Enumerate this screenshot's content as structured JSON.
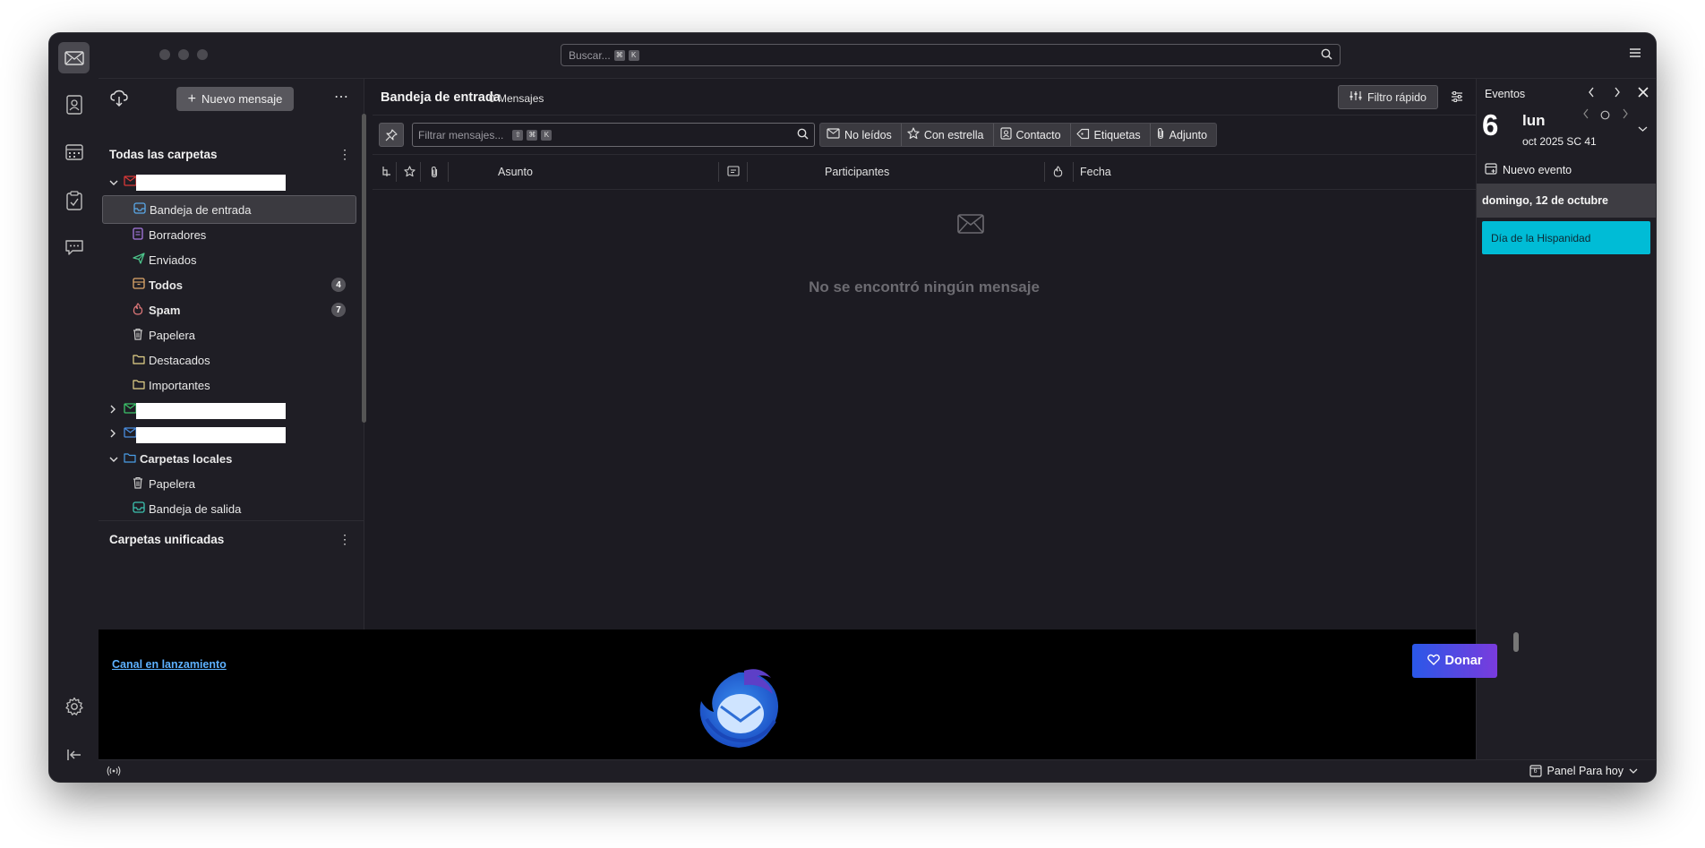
{
  "header": {
    "search_placeholder": "Buscar...",
    "search_kbd": [
      "⌘",
      "K"
    ]
  },
  "folderpane": {
    "new_message_label": "Nuevo mensaje",
    "all_folders_title": "Todas las carpetas",
    "account_folders": [
      {
        "label": "Bandeja de entrada",
        "bold": false,
        "badge": ""
      },
      {
        "label": "Borradores",
        "bold": false,
        "badge": ""
      },
      {
        "label": "Enviados",
        "bold": false,
        "badge": ""
      },
      {
        "label": "Todos",
        "bold": true,
        "badge": "4"
      },
      {
        "label": "Spam",
        "bold": true,
        "badge": "7"
      },
      {
        "label": "Papelera",
        "bold": false,
        "badge": ""
      },
      {
        "label": "Destacados",
        "bold": false,
        "badge": ""
      },
      {
        "label": "Importantes",
        "bold": false,
        "badge": ""
      }
    ],
    "local_folders_label": "Carpetas locales",
    "local_folders": [
      {
        "label": "Papelera"
      },
      {
        "label": "Bandeja de salida"
      }
    ],
    "unified_title": "Carpetas unificadas"
  },
  "messagepane": {
    "folder_title": "Bandeja de entrada",
    "message_count": "0 Mensajes",
    "quick_filter_label": "Filtro rápido",
    "filter_placeholder": "Filtrar mensajes...",
    "filter_kbd": [
      "⇧",
      "⌘",
      "K"
    ],
    "filter_buttons": [
      "No leídos",
      "Con estrella",
      "Contacto",
      "Etiquetas",
      "Adjunto"
    ],
    "columns": {
      "subject": "Asunto",
      "participants": "Participantes",
      "date": "Fecha"
    },
    "empty_text": "No se encontró ningún mensaje"
  },
  "todaypane": {
    "title": "Eventos",
    "day_number": "6",
    "day_name": "lun",
    "month_line": "oct 2025  SC 41",
    "new_event_label": "Nuevo evento",
    "day_header": "domingo, 12 de octubre",
    "event_title": "Día de la Hispanidad",
    "event_color": "#00bcd6"
  },
  "banner": {
    "channel_link": "Canal en lanzamiento",
    "donate_label": "Donar"
  },
  "statusbar": {
    "today_panel_label": "Panel Para hoy",
    "calendar_day": "6"
  }
}
